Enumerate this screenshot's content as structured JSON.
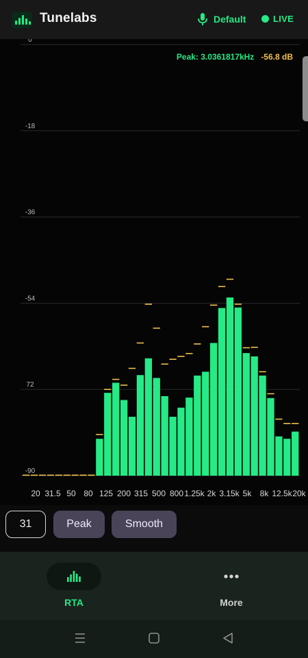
{
  "header": {
    "app_icon": "equalizer-bars-icon",
    "title": "Tunelabs",
    "mic_icon": "microphone-icon",
    "input_label": "Default",
    "live_icon": "live-dot-icon",
    "live_label": "LIVE"
  },
  "readout": {
    "peak_freq": "Peak: 3.0361817kHz",
    "peak_db": "-56.8 dB"
  },
  "colors": {
    "accent": "#25ea86",
    "peak_hold": "#f0c04a",
    "background": "#050505",
    "button_bg": "#4a4458"
  },
  "chart_data": {
    "type": "bar",
    "ylim": [
      -90,
      0
    ],
    "y_tick_labels": [
      "0",
      "-18",
      "-36",
      "-54",
      "72",
      "-90"
    ],
    "y_tick_values": [
      0,
      -18,
      -36,
      -54,
      -72,
      -90
    ],
    "x_tick_labels": [
      "20",
      "31.5",
      "50",
      "80",
      "125",
      "200",
      "315",
      "500",
      "800",
      "1.25k",
      "2k",
      "3.15k",
      "5k",
      "8k",
      "12.5k",
      "20k"
    ],
    "bands": 31,
    "values": [
      -90,
      -90,
      -90,
      -90,
      -90,
      -90,
      -90,
      -90,
      -90,
      -82.3,
      -72.7,
      -70.6,
      -74.2,
      -77.7,
      -69.0,
      -65.5,
      -69.6,
      -73.4,
      -77.7,
      -75.8,
      -73.7,
      -69.1,
      -68.3,
      -62.3,
      -55.0,
      -52.8,
      -54.9,
      -64.4,
      -65.1,
      -69.1,
      -73.8,
      -81.8,
      -82.3,
      -80.8
    ],
    "peak_hold": [
      -90,
      -90,
      -90,
      -90,
      -90,
      -90,
      -90,
      -90,
      -90,
      -81.5,
      -72.1,
      -70.0,
      -71.2,
      -67.7,
      -62.4,
      -54.3,
      -59.3,
      -66.8,
      -65.8,
      -65.2,
      -64.6,
      -62.6,
      -59.0,
      -54.5,
      -50.6,
      -49.1,
      -54.3,
      -63.4,
      -63.3,
      -68.4,
      -73.0,
      -78.3,
      -79.2,
      -79.2
    ]
  },
  "controls": {
    "bands_value": "31",
    "peak_label": "Peak",
    "smooth_label": "Smooth"
  },
  "nav": {
    "rta_icon": "spectrum-bars-icon",
    "rta_label": "RTA",
    "more_icon": "more-dots-icon",
    "more_label": "More"
  },
  "system_bar": {
    "recents_icon": "menu-lines-icon",
    "home_icon": "home-square-icon",
    "back_icon": "back-triangle-icon"
  }
}
